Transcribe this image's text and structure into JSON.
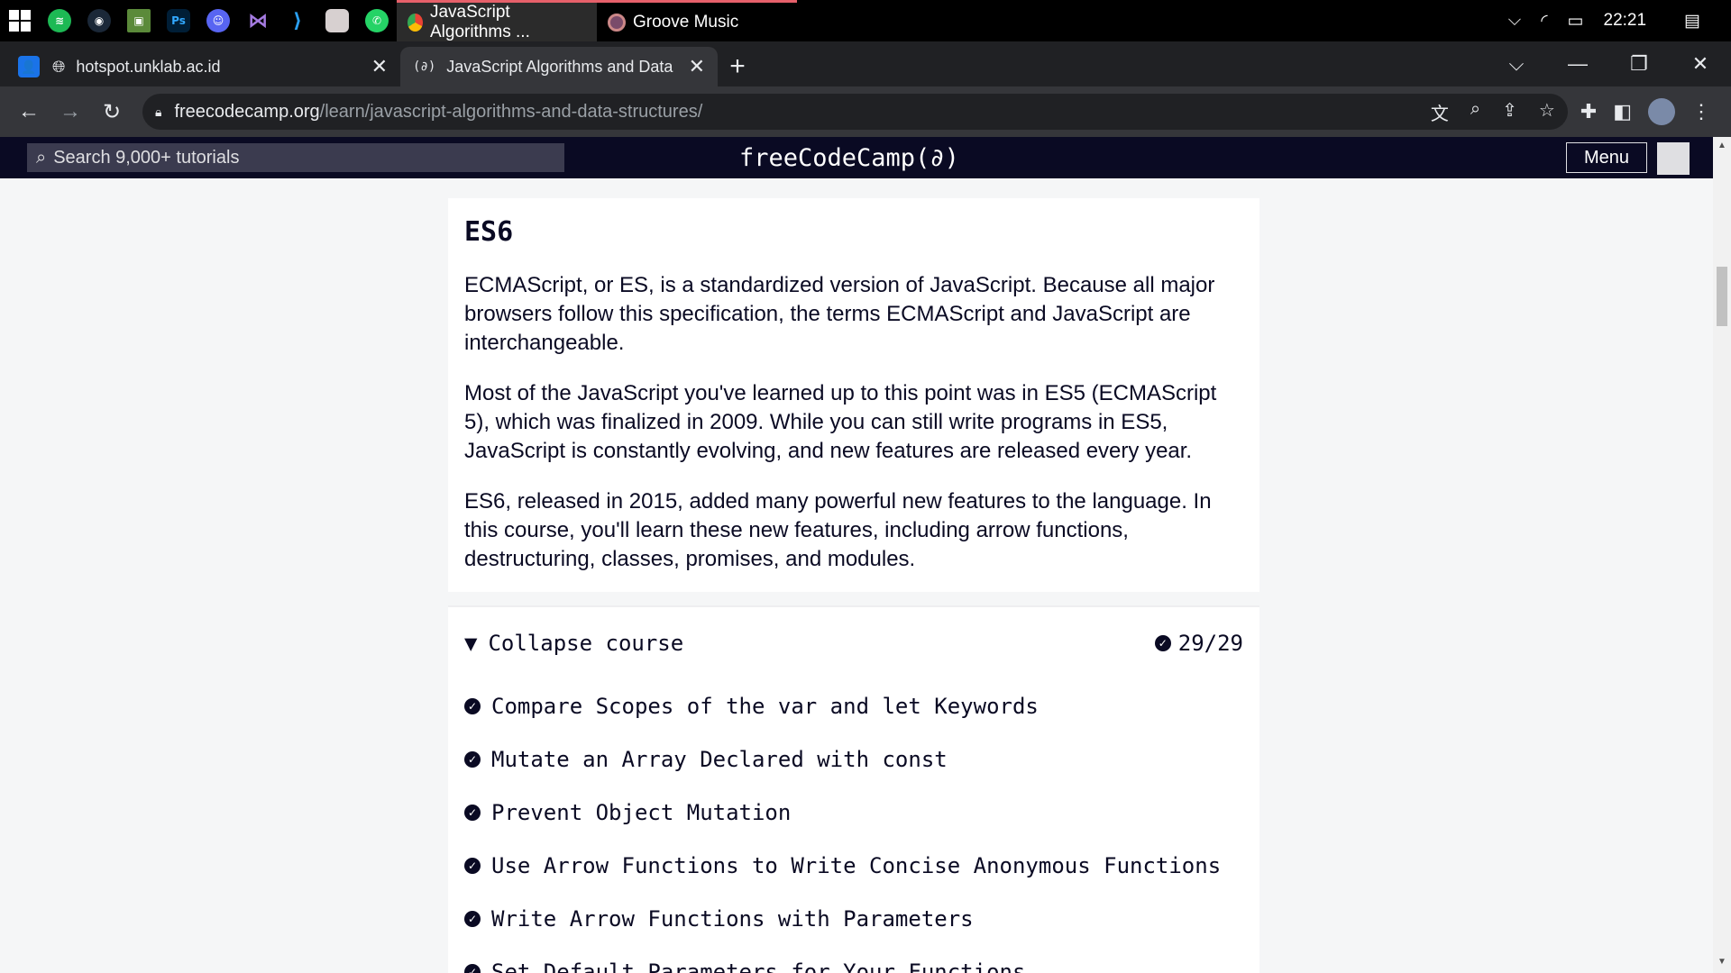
{
  "taskbar": {
    "apps": [
      {
        "name": "spotify-icon",
        "color": "#1db954"
      },
      {
        "name": "steam-icon",
        "color": "#1b2838"
      },
      {
        "name": "minecraft-icon",
        "color": "#5b8a3a"
      },
      {
        "name": "photoshop-icon",
        "color": "#001e36"
      },
      {
        "name": "discord-icon",
        "color": "#5865f2"
      },
      {
        "name": "visual-studio-icon",
        "color": "#7b4fb8"
      },
      {
        "name": "vscode-icon",
        "color": "#0078d4"
      },
      {
        "name": "anime-app-icon",
        "color": "#d7d0d0"
      },
      {
        "name": "whatsapp-icon",
        "color": "#25d366"
      }
    ],
    "tasks": [
      {
        "label": "JavaScript Algorithms ..."
      },
      {
        "label": "Groove Music"
      }
    ],
    "clock": "22:21"
  },
  "browser": {
    "tabs": [
      {
        "title": "hotspot.unklab.ac.id"
      },
      {
        "title": "JavaScript Algorithms and Data S"
      }
    ],
    "url_host": "freecodecamp.org",
    "url_path": "/learn/javascript-algorithms-and-data-structures/"
  },
  "fcc": {
    "search_placeholder": "Search 9,000+ tutorials",
    "logo": "freeCodeCamp(∂)",
    "menu_label": "Menu"
  },
  "course": {
    "title": "ES6",
    "paragraphs": [
      "ECMAScript, or ES, is a standardized version of JavaScript. Because all major browsers follow this specification, the terms ECMAScript and JavaScript are interchangeable.",
      "Most of the JavaScript you've learned up to this point was in ES5 (ECMAScript 5), which was finalized in 2009. While you can still write programs in ES5, JavaScript is constantly evolving, and new features are released every year.",
      "ES6, released in 2015, added many powerful new features to the language. In this course, you'll learn these new features, including arrow functions, destructuring, classes, promises, and modules."
    ],
    "collapse_label": "Collapse course",
    "progress": "29/29",
    "lessons": [
      "Compare Scopes of the var and let Keywords",
      "Mutate an Array Declared with const",
      "Prevent Object Mutation",
      "Use Arrow Functions to Write Concise Anonymous Functions",
      "Write Arrow Functions with Parameters",
      "Set Default Parameters for Your Functions"
    ]
  }
}
